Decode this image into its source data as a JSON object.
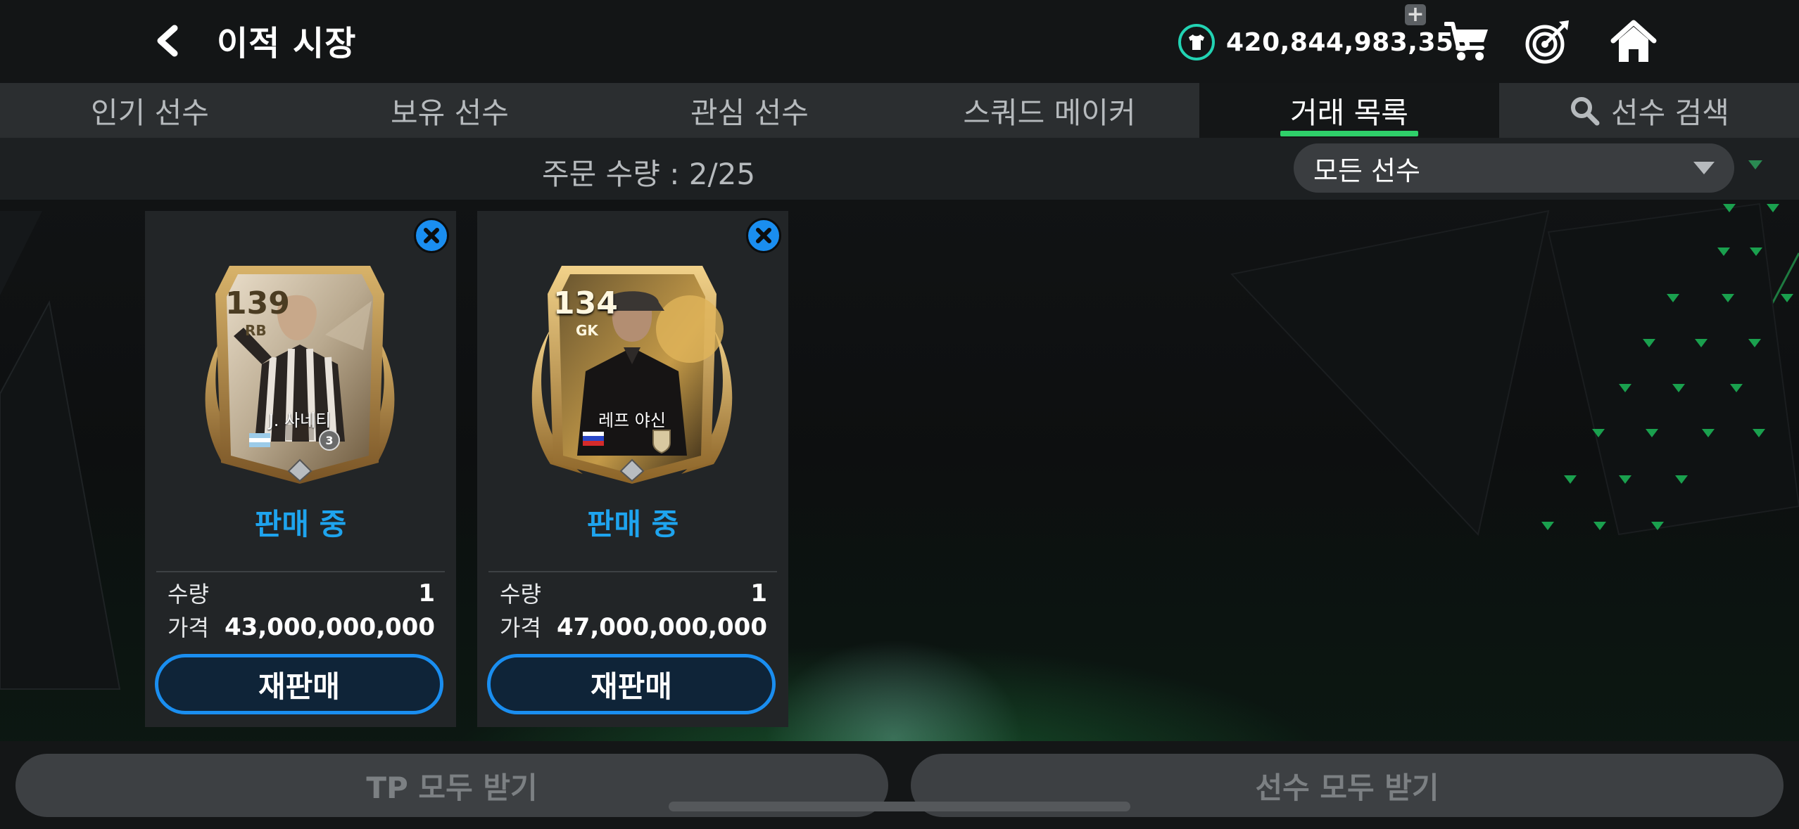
{
  "header": {
    "back_icon": "chevron-left-icon",
    "title": "이적 시장",
    "tp_icon": "jersey-icon",
    "tp_amount": "420,844,983,355",
    "tp_plus": "+",
    "cart_icon": "cart-icon",
    "target_icon": "target-icon",
    "home_icon": "home-icon"
  },
  "tabs": [
    {
      "label": "인기 선수"
    },
    {
      "label": "보유 선수"
    },
    {
      "label": "관심 선수"
    },
    {
      "label": "스쿼드 메이커"
    },
    {
      "label": "거래 목록",
      "active": true
    },
    {
      "label": "선수 검색",
      "icon": "search-icon"
    }
  ],
  "subbar": {
    "order_count": "주문 수량 : 2/25",
    "filter_selected": "모든 선수"
  },
  "listings": [
    {
      "ovr": "139",
      "position": "RB",
      "name": "J. 사네티",
      "level": "3",
      "status": "판매 중",
      "qty_label": "수량",
      "qty": "1",
      "price_label": "가격",
      "price": "43,000,000,000",
      "resell_label": "재판매"
    },
    {
      "ovr": "134",
      "position": "GK",
      "name": "레프 야신",
      "status": "판매 중",
      "qty_label": "수량",
      "qty": "1",
      "price_label": "가격",
      "price": "47,000,000,000",
      "resell_label": "재판매"
    }
  ],
  "footer": {
    "claim_tp": "TP 모두 받기",
    "claim_players": "선수 모두 받기"
  },
  "colors": {
    "accent_blue": "#1a8ef0",
    "status_blue": "#1ea4ee",
    "tab_underline": "#2fd06a",
    "tp_ring": "#22d3b3"
  }
}
